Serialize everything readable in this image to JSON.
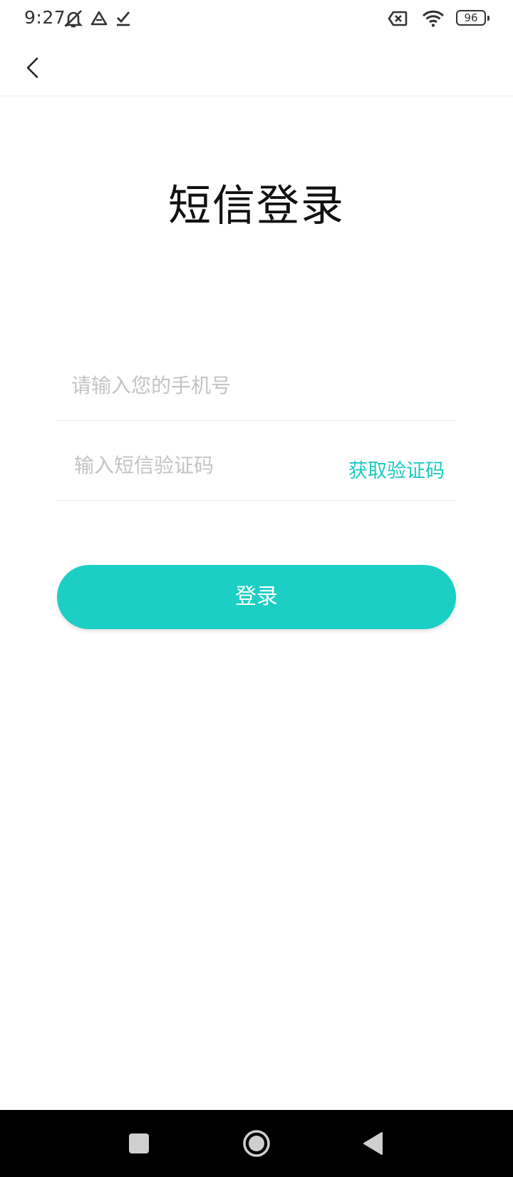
{
  "status_bar": {
    "time": "9:27",
    "battery_level": "96",
    "icons": [
      "mute-notification-icon",
      "drive-icon",
      "checkmark-icon",
      "no-sim-icon",
      "wifi-icon",
      "battery-icon"
    ]
  },
  "app_bar": {
    "back_icon": "chevron-left-icon"
  },
  "page": {
    "title": "短信登录"
  },
  "form": {
    "phone": {
      "placeholder": "请输入您的手机号",
      "value": ""
    },
    "code": {
      "placeholder": "输入短信验证码",
      "value": "",
      "get_code_label": "获取验证码"
    },
    "login_label": "登录"
  },
  "colors": {
    "accent": "#1ccfc5",
    "accent_text": "#1ccbc3",
    "placeholder": "#c4c4c4",
    "nav_bar": "#000000"
  },
  "nav_bar": {
    "icons": [
      "recents-square-icon",
      "home-circle-icon",
      "back-triangle-icon"
    ]
  }
}
